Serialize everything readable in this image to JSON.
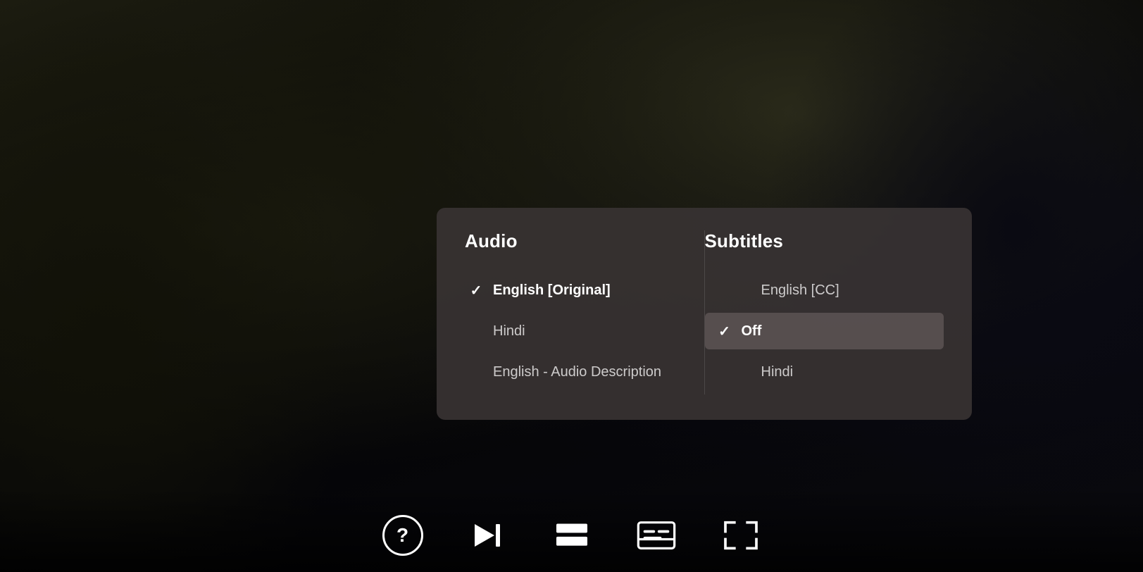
{
  "panel": {
    "audio": {
      "header": "Audio",
      "options": [
        {
          "id": "english-original",
          "label": "English [Original]",
          "selected": true,
          "highlighted": false
        },
        {
          "id": "hindi",
          "label": "Hindi",
          "selected": false,
          "highlighted": false
        },
        {
          "id": "english-audio-description",
          "label": "English - Audio Description",
          "selected": false,
          "highlighted": false
        }
      ]
    },
    "subtitles": {
      "header": "Subtitles",
      "options": [
        {
          "id": "english-cc",
          "label": "English [CC]",
          "selected": false,
          "highlighted": false
        },
        {
          "id": "off",
          "label": "Off",
          "selected": true,
          "highlighted": true
        },
        {
          "id": "hindi-sub",
          "label": "Hindi",
          "selected": false,
          "highlighted": false
        }
      ]
    }
  },
  "controls": {
    "help_label": "?",
    "skip_next_label": "⏭",
    "episodes_label": "episodes",
    "subtitles_label": "subtitles",
    "fullscreen_label": "fullscreen"
  }
}
